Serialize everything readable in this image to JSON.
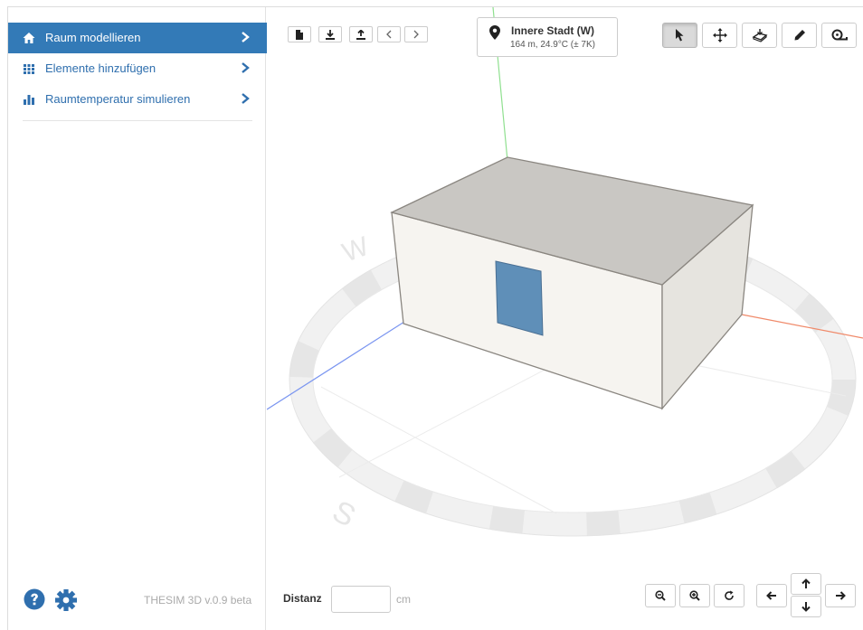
{
  "app": {
    "version": "THESIM 3D v.0.9 beta"
  },
  "colors": {
    "accent": "#337ab7",
    "link": "#2f6fae",
    "x_axis": "#f08a6a",
    "y_axis": "#8fe08f",
    "z_axis": "#7a95f0",
    "window": "#5f8fb8"
  },
  "sidebar": {
    "items": [
      {
        "label": "Raum modellieren",
        "icon": "home-icon",
        "active": true
      },
      {
        "label": "Elemente hinzufügen",
        "icon": "grid-icon",
        "active": false
      },
      {
        "label": "Raumtemperatur simulieren",
        "icon": "bar-chart-icon",
        "active": false
      }
    ],
    "footer": {
      "help_icon": "question-circle-icon",
      "settings_icon": "gear-icon"
    }
  },
  "toolbar": {
    "file_buttons": [
      "new-file-icon",
      "download-icon",
      "upload-icon",
      "undo-icon",
      "redo-icon"
    ],
    "tools": [
      "cursor-icon",
      "move-icon",
      "extrude-icon",
      "pencil-icon",
      "measure-tape-icon"
    ],
    "active_tool": "cursor-icon"
  },
  "location": {
    "name": "Innere Stadt (W)",
    "info": "164 m, 24.9°C (± 7K)"
  },
  "compass": {
    "w": "W",
    "s": "S"
  },
  "distance": {
    "label": "Distanz",
    "value": "",
    "unit": "cm"
  },
  "view_controls": [
    "zoom-out-icon",
    "zoom-in-icon",
    "reset-view-icon",
    "arrow-left-icon",
    "arrow-up-icon",
    "arrow-down-icon",
    "arrow-right-icon"
  ]
}
